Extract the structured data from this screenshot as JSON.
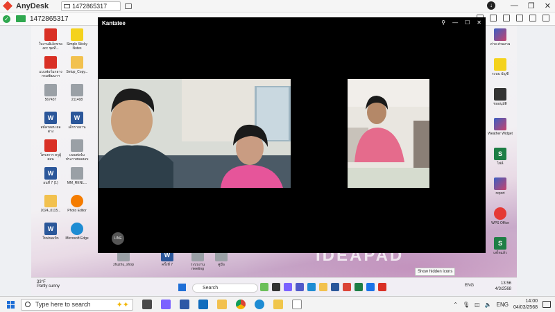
{
  "anydesk": {
    "app_name": "AnyDesk",
    "tab_label": "1472865317",
    "address_id": "1472865317"
  },
  "desktop_icons_left": [
    {
      "label": "ใบงานอิเล็กทรอ acc ชุดที่...",
      "kind": "pdf"
    },
    {
      "label": "Simple Sticky Notes",
      "kind": "yellow"
    },
    {
      "label": "แบบฟอร์มกลาง กรมพัฒนาฯ",
      "kind": "pdf"
    },
    {
      "label": "Setup_Copy...",
      "kind": "folder"
    },
    {
      "label": "567437",
      "kind": "grey"
    },
    {
      "label": "211408",
      "kind": "grey"
    },
    {
      "label": "สมัครสอบ ผลต่าง",
      "kind": "word"
    },
    {
      "label": "เด็กรายงาน",
      "kind": "word"
    },
    {
      "label": "โครงการ ครูผู้สอน",
      "kind": "pdf"
    },
    {
      "label": "แบบฟอร์ม ประกาศผลสอบ",
      "kind": "grey"
    },
    {
      "label": "อนที่ 7 (1)",
      "kind": "word"
    },
    {
      "label": "MM_RENL...",
      "kind": "grey"
    },
    {
      "label": "2024_0115...",
      "kind": "folder"
    },
    {
      "label": "Photo Editor",
      "kind": "photo"
    },
    {
      "label": "ใหม่ขอเบิก",
      "kind": "word"
    },
    {
      "label": "Microsoft Edge",
      "kind": "edge"
    }
  ],
  "desktop_icons_right": [
    {
      "label": "ค่าย ส่วนงาน",
      "kind": "mixed"
    },
    {
      "label": "ระบบ บัญชี",
      "kind": "yellow"
    },
    {
      "label": "ขออนุมัติ",
      "kind": "dark"
    },
    {
      "label": "Weather Widget",
      "kind": "mixed"
    },
    {
      "label": "ไฟล์",
      "kind": "excel"
    },
    {
      "label": "report",
      "kind": "mixed"
    },
    {
      "label": "WPS Office",
      "kind": "wps"
    },
    {
      "label": "เสร็จแล้ว",
      "kind": "excel"
    }
  ],
  "bottom_icons": [
    {
      "label": "zhuzhu_shop"
    },
    {
      "label": "ครั้งที่ 7"
    },
    {
      "label": "ระบบงาน meeting"
    },
    {
      "label": "คู่มือ"
    }
  ],
  "video_call": {
    "title": "Kantatee",
    "controls": [
      "pin",
      "minimize",
      "maximize",
      "close"
    ],
    "watermark": "LINE"
  },
  "tooltip": "Show hidden icons",
  "inner_taskbar": {
    "weather_temp": "33°F",
    "weather_desc": "Partly sunny",
    "search_placeholder": "Search",
    "lang": "ENG",
    "time": "13:56",
    "date": "4/3/2568"
  },
  "taskbar": {
    "search_placeholder": "Type here to search",
    "lang": "ENG",
    "time": "14:00",
    "date": "04/03/2568"
  },
  "colors": {
    "anydesk_red": "#e8412c",
    "ok_green": "#2fa84f",
    "windows_blue": "#1f6fd6"
  }
}
